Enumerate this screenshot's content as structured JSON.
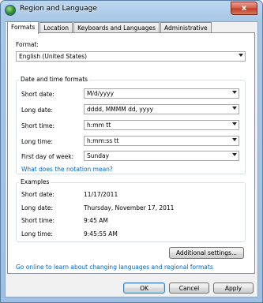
{
  "window": {
    "title": "Region and Language",
    "close_label": "x"
  },
  "tabs": [
    {
      "label": "Formats",
      "active": true
    },
    {
      "label": "Location",
      "active": false
    },
    {
      "label": "Keyboards and Languages",
      "active": false
    },
    {
      "label": "Administrative",
      "active": false
    }
  ],
  "format": {
    "label": "Format:",
    "value": "English (United States)"
  },
  "datetime": {
    "group_title": "Date and time formats",
    "short_date": {
      "label": "Short date:",
      "value": "M/d/yyyy"
    },
    "long_date": {
      "label": "Long date:",
      "value": "dddd, MMMM dd, yyyy"
    },
    "short_time": {
      "label": "Short time:",
      "value": "h:mm tt"
    },
    "long_time": {
      "label": "Long time:",
      "value": "h:mm:ss tt"
    },
    "first_day": {
      "label": "First day of week:",
      "value": "Sunday"
    },
    "notation_link": "What does the notation mean?"
  },
  "examples": {
    "group_title": "Examples",
    "rows": [
      {
        "label": "Short date:",
        "value": "11/17/2011"
      },
      {
        "label": "Long date:",
        "value": "Thursday, November 17, 2011"
      },
      {
        "label": "Short time:",
        "value": "9:45 AM"
      },
      {
        "label": "Long time:",
        "value": "9:45:55 AM"
      }
    ]
  },
  "additional_settings_label": "Additional settings...",
  "online_link": "Go online to learn about changing languages and regional formats",
  "buttons": {
    "ok": "OK",
    "cancel": "Cancel",
    "apply": "Apply"
  }
}
